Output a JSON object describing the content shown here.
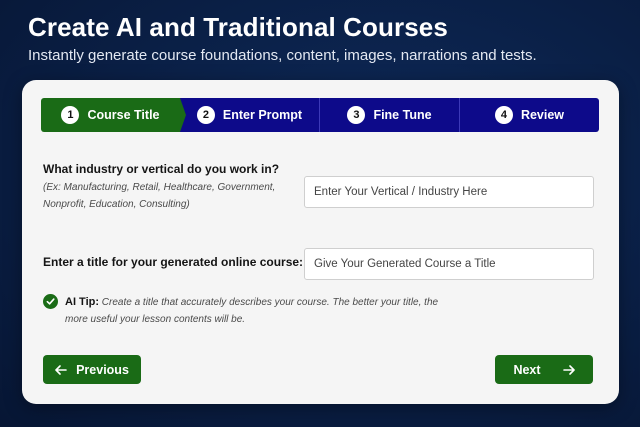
{
  "hero": {
    "title": "Create AI and Traditional Courses",
    "subtitle": "Instantly generate course foundations, content, images, narrations and tests."
  },
  "stepper": {
    "active_index": 0,
    "steps": [
      {
        "number": "1",
        "label": "Course Title"
      },
      {
        "number": "2",
        "label": "Enter Prompt"
      },
      {
        "number": "3",
        "label": "Fine Tune"
      },
      {
        "number": "4",
        "label": "Review"
      }
    ]
  },
  "form": {
    "industry": {
      "label": "What industry or vertical do you work in?",
      "hint": "(Ex: Manufacturing, Retail, Healthcare, Government, Nonprofit, Education, Consulting)",
      "placeholder": "Enter Your Vertical / Industry Here",
      "value": ""
    },
    "course_title": {
      "label": "Enter a title for your generated online course:",
      "placeholder": "Give Your Generated Course a Title",
      "value": ""
    },
    "tip": {
      "label": "AI Tip:",
      "text": "Create a title that accurately describes your course. The better your title, the more useful your lesson contents will be."
    }
  },
  "nav": {
    "previous_label": "Previous",
    "next_label": "Next"
  },
  "colors": {
    "background": "#0a1f45",
    "card": "#f5f5f5",
    "step_active": "#1a6b16",
    "step_inactive": "#0d0a8a",
    "button": "#1a6b16"
  },
  "icons": {
    "tip": "check-circle-icon",
    "previous": "arrow-left-icon",
    "next": "arrow-right-icon"
  }
}
